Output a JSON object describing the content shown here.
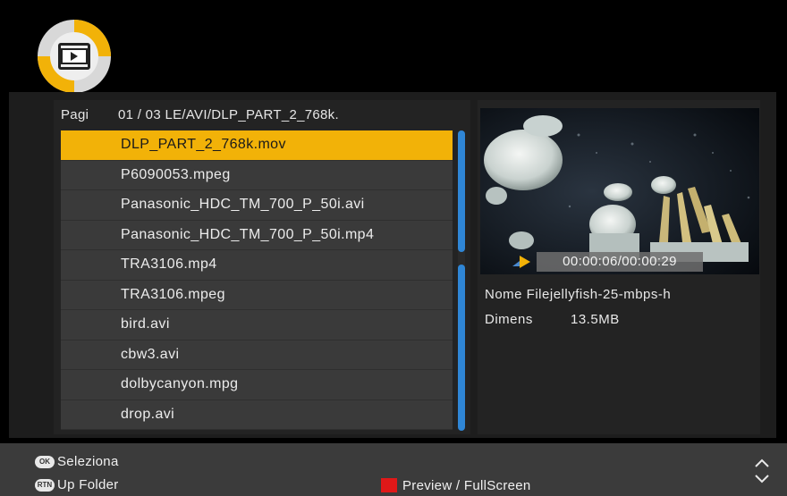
{
  "header": {
    "logo_icon": "video-folder-icon"
  },
  "file_browser": {
    "page_label": "Pagi",
    "page_value": "01 / 03 LE/AVI/DLP_PART_2_768k.",
    "files": [
      "DLP_PART_2_768k.mov",
      "P6090053.mpeg",
      "Panasonic_HDC_TM_700_P_50i.avi",
      "Panasonic_HDC_TM_700_P_50i.mp4",
      "TRA3106.mp4",
      "TRA3106.mpeg",
      "bird.avi",
      "cbw3.avi",
      "dolbycanyon.mpg",
      "drop.avi"
    ],
    "selected_index": 0
  },
  "preview": {
    "time": "00:00:06/00:00:29",
    "filename_label": "Nome File",
    "filename_value": "jellyfish-25-mbps-h",
    "size_label": "Dimens",
    "size_value": "13.5MB"
  },
  "footer": {
    "ok_key": "OK",
    "ok_label": "Seleziona",
    "rtn_key": "RTN",
    "rtn_label": "Up Folder",
    "red_label": "Preview / FullScreen"
  },
  "colors": {
    "selected": "#f2b208",
    "scrollbar": "#2f86d6",
    "red_key": "#e01818"
  }
}
